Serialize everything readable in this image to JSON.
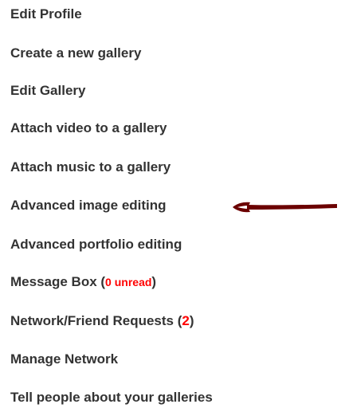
{
  "menu": {
    "items": [
      {
        "label": "Edit Profile"
      },
      {
        "label": "Create a new gallery"
      },
      {
        "label": "Edit Gallery"
      },
      {
        "label": "Attach video to a gallery"
      },
      {
        "label": "Attach music to a gallery"
      },
      {
        "label": "Advanced image editing"
      },
      {
        "label": "Advanced portfolio editing"
      },
      {
        "label": "Message Box (",
        "count": "0",
        "count_label": "unread",
        "suffix": ")"
      },
      {
        "label": "Network/Friend Requests (",
        "count": "2",
        "suffix": ")"
      },
      {
        "label": "Manage Network"
      },
      {
        "label": "Tell people about your galleries"
      }
    ]
  },
  "annotation": {
    "arrow_color": "#6b0000",
    "points_to": "Advanced image editing"
  },
  "colors": {
    "text": "#333333",
    "count": "#ff0000",
    "background": "#ffffff"
  }
}
